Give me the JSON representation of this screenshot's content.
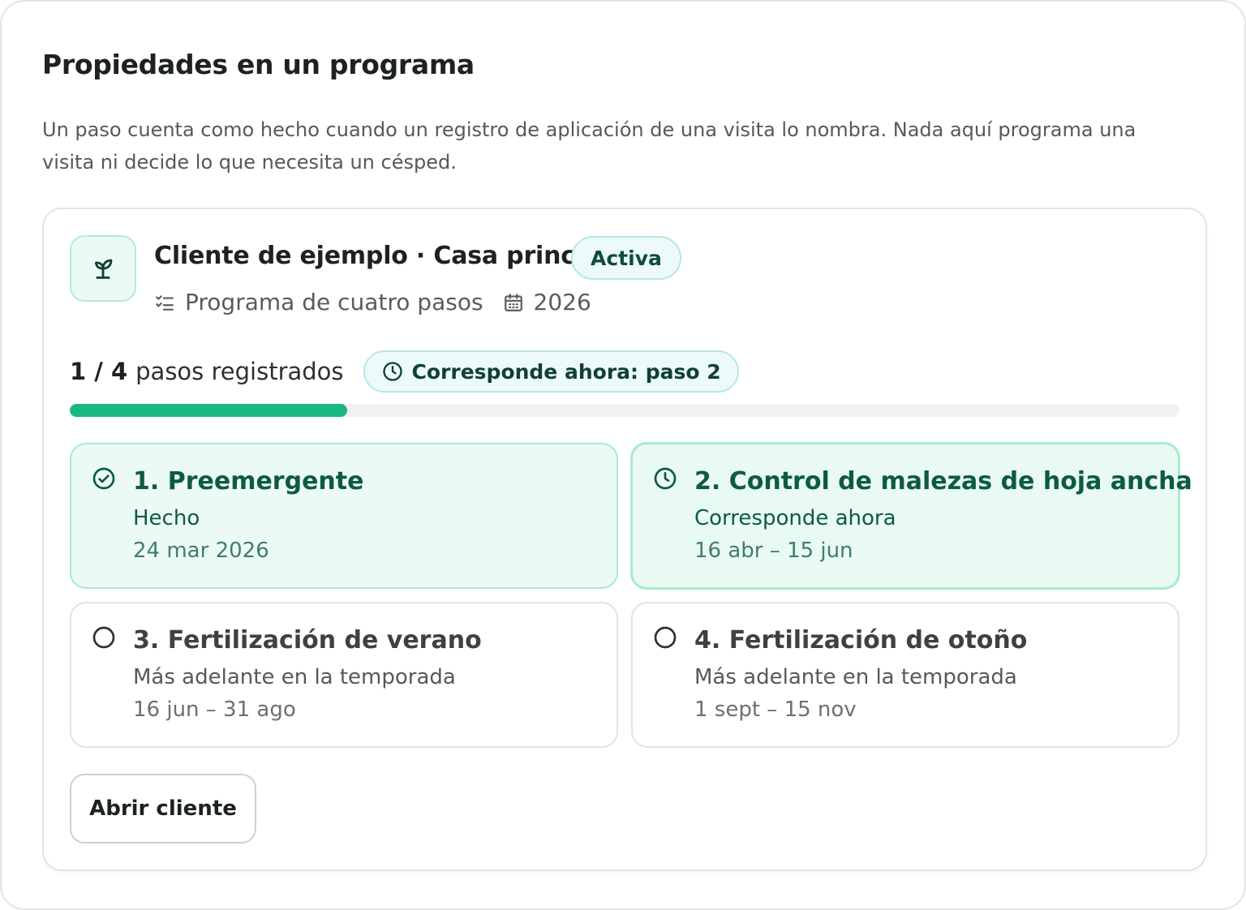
{
  "page": {
    "title": "Propiedades en un programa",
    "intro": "Un paso cuenta como hecho cuando un registro de aplicación de una visita lo nombra. Nada aquí programa una visita ni decide lo que necesita un césped."
  },
  "property": {
    "icon": "sprout-icon",
    "name": "Cliente de ejemplo · Casa principal",
    "status": "Activa",
    "program_icon": "checklist-icon",
    "program": "Programa de cuatro pasos",
    "year_icon": "calendar-icon",
    "year": "2026"
  },
  "progress": {
    "count": "1 / 4",
    "label": "pasos registrados",
    "fraction": 0.25,
    "due_icon": "clock-icon",
    "due_label": "Corresponde ahora: paso 2"
  },
  "steps": [
    {
      "state": "done",
      "icon": "check-circle-icon",
      "title": "1. Preemergente",
      "status": "Hecho",
      "date": "24 mar 2026"
    },
    {
      "state": "current",
      "icon": "clock-icon",
      "title": "2. Control de malezas de hoja ancha",
      "status": "Corresponde ahora",
      "date": "16 abr – 15 jun"
    },
    {
      "state": "future",
      "icon": "empty-circle-icon",
      "title": "3. Fertilización de verano",
      "status": "Más adelante en la temporada",
      "date": "16 jun – 31 ago"
    },
    {
      "state": "future",
      "icon": "empty-circle-icon",
      "title": "4. Fertilización de otoño",
      "status": "Más adelante en la temporada",
      "date": "1 sept – 15 nov"
    }
  ],
  "actions": {
    "open_client": "Abrir cliente"
  },
  "colors": {
    "accent": "#17b981",
    "accent_dark": "#0d5a42",
    "pill_bg": "#ecfbfa",
    "done_bg": "#ebfbf3"
  }
}
